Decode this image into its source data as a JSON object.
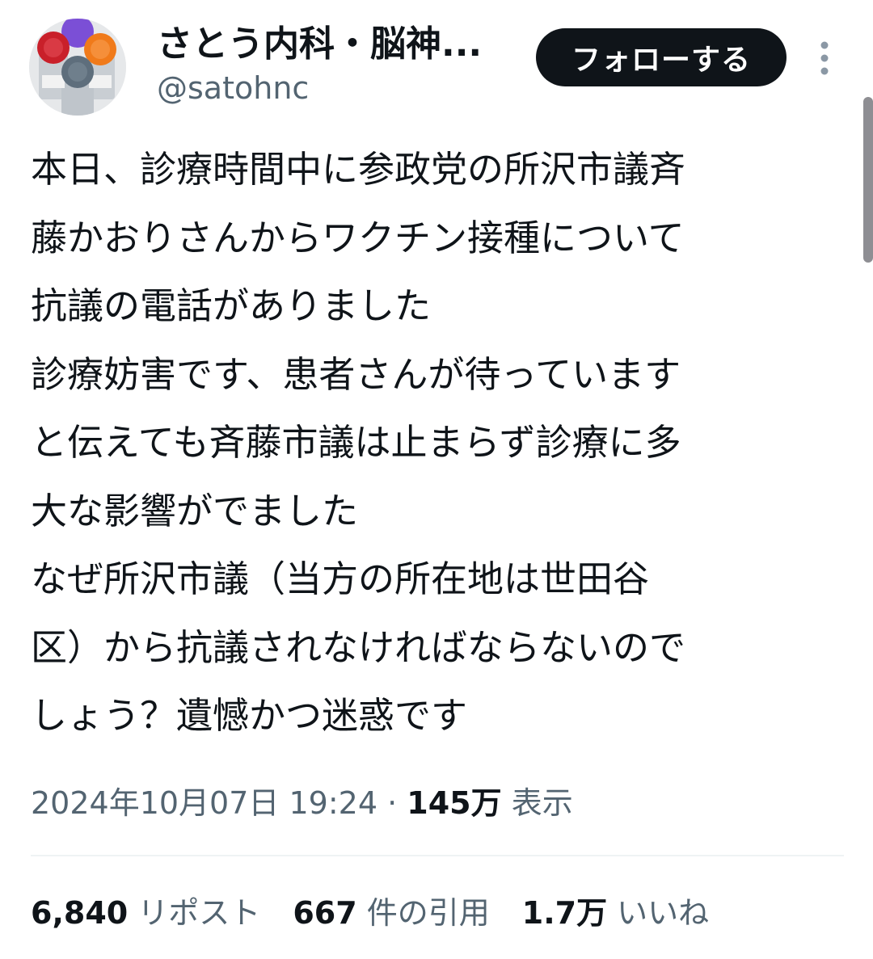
{
  "header": {
    "display_name": "さとう内科・脳神...",
    "handle": "@satohnc",
    "follow_label": "フォローする",
    "avatar_icon": "vaccine-vials-avatar",
    "more_icon": "vertical-ellipsis-icon"
  },
  "tweet": {
    "lines": [
      "本日、診療時間中に参政党の所沢市議斉",
      "藤かおりさんからワクチン接種について",
      "抗議の電話がありました",
      "診療妨害です、患者さんが待っています",
      "と伝えても斉藤市議は止まらず診療に多",
      "大な影響がでました",
      "なぜ所沢市議（当方の所在地は世田谷",
      "区）から抗議されなければならないので",
      "しょう？遺憾かつ迷惑です"
    ]
  },
  "meta": {
    "timestamp": "2024年10月07日 19:24",
    "separator": "·",
    "views_count": "145万",
    "views_label": "表示"
  },
  "stats": {
    "reposts_count": "6,840",
    "reposts_label": "リポスト",
    "quotes_count": "667",
    "quotes_label": "件の引用",
    "likes_count": "1.7万",
    "likes_label": "いいね"
  },
  "colors": {
    "text": "#0f1419",
    "secondary": "#536471",
    "button_bg": "#0f1419",
    "divider": "#eff3f4"
  }
}
